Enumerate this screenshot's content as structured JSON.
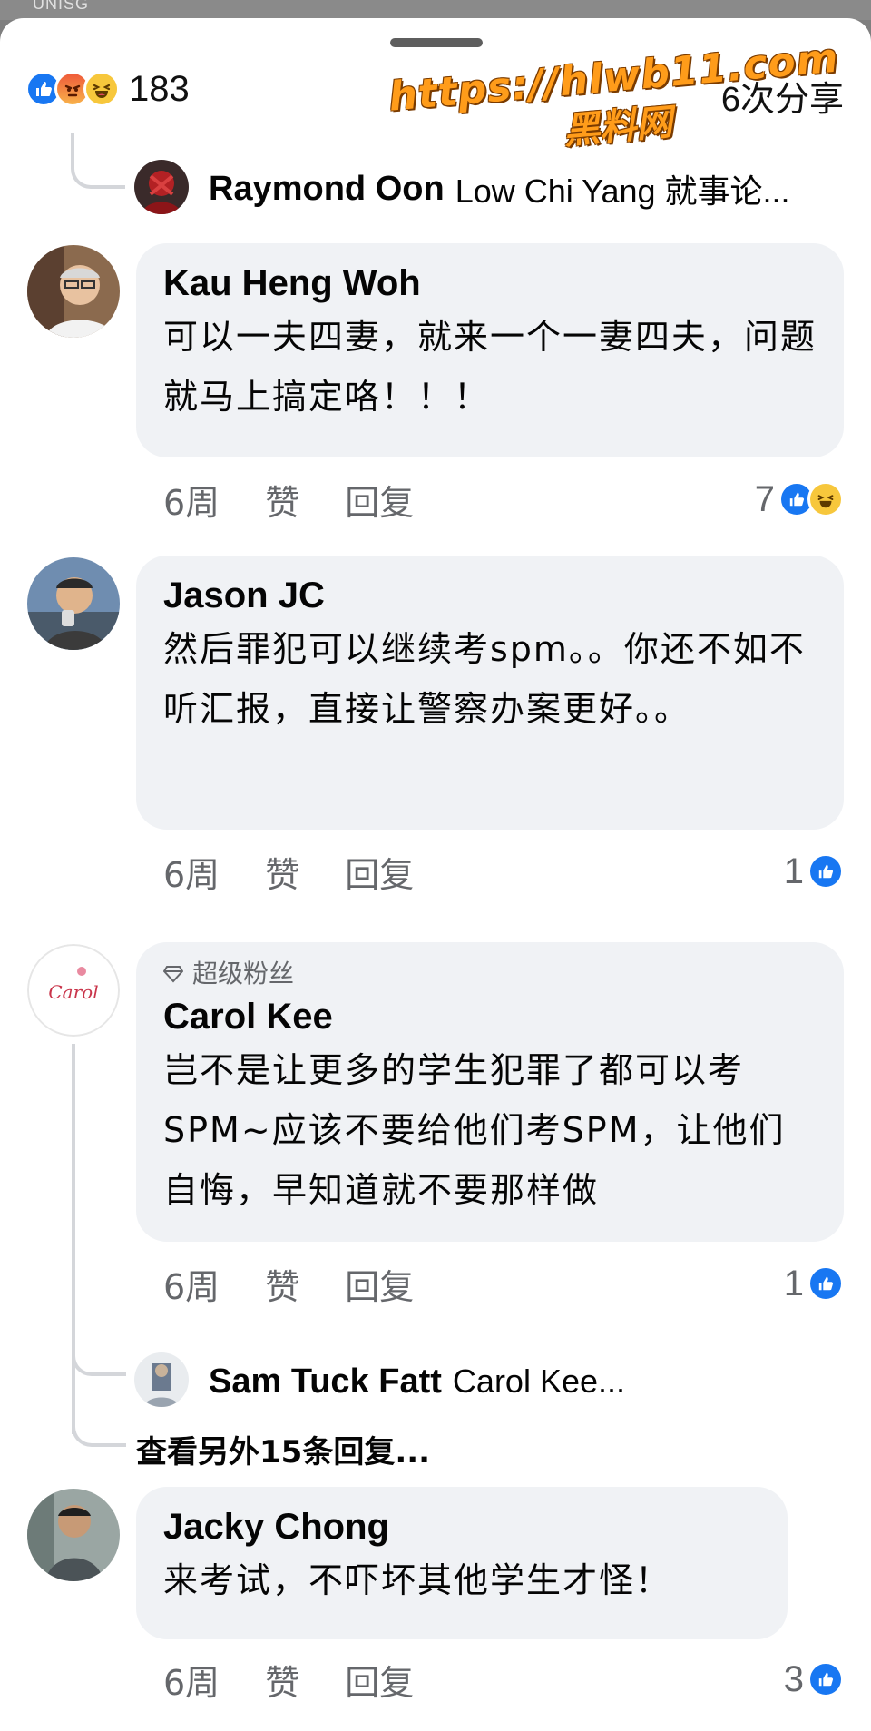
{
  "status_bar": {
    "carrier": "UNISG"
  },
  "summary": {
    "reactions": [
      "like-icon",
      "angry-icon",
      "haha-icon"
    ],
    "count": "183",
    "shares": "6次分享"
  },
  "watermark": {
    "url": "https://hlwb11.com",
    "name": "黑料网"
  },
  "colors": {
    "like": "#1877f2",
    "bubble": "#f0f2f5",
    "meta": "#65676b",
    "watermark": "#ff9c1a"
  },
  "thread_top": {
    "name": "Raymond Oon",
    "text": "Low Chi Yang 就事论..."
  },
  "comments": [
    {
      "author": "Kau Heng Woh",
      "text": "可以一夫四妻，就来一个一妻四夫，问题就马上搞定咯！！！",
      "time": "6周",
      "like": "赞",
      "reply": "回复",
      "reaction_count": "7"
    },
    {
      "author": "Jason JC",
      "text": "然后罪犯可以继续考spm。。你还不如不听汇报，直接让警察办案更好。。",
      "time": "6周",
      "like": "赞",
      "reply": "回复",
      "reaction_count": "1"
    },
    {
      "badge": "超级粉丝",
      "author": "Carol Kee",
      "text": "岂不是让更多的学生犯罪了都可以考SPM~应该不要给他们考SPM，让他们自悔，早知道就不要那样做",
      "time": "6周",
      "like": "赞",
      "reply": "回复",
      "reaction_count": "1",
      "reply_preview": {
        "name": "Sam Tuck Fatt",
        "text": "Carol Kee..."
      },
      "more_replies": "查看另外15条回复..."
    },
    {
      "author": "Jacky Chong",
      "text": "来考试，不吓坏其他学生才怪！",
      "time": "6周",
      "like": "赞",
      "reply": "回复",
      "reaction_count": "3"
    }
  ]
}
